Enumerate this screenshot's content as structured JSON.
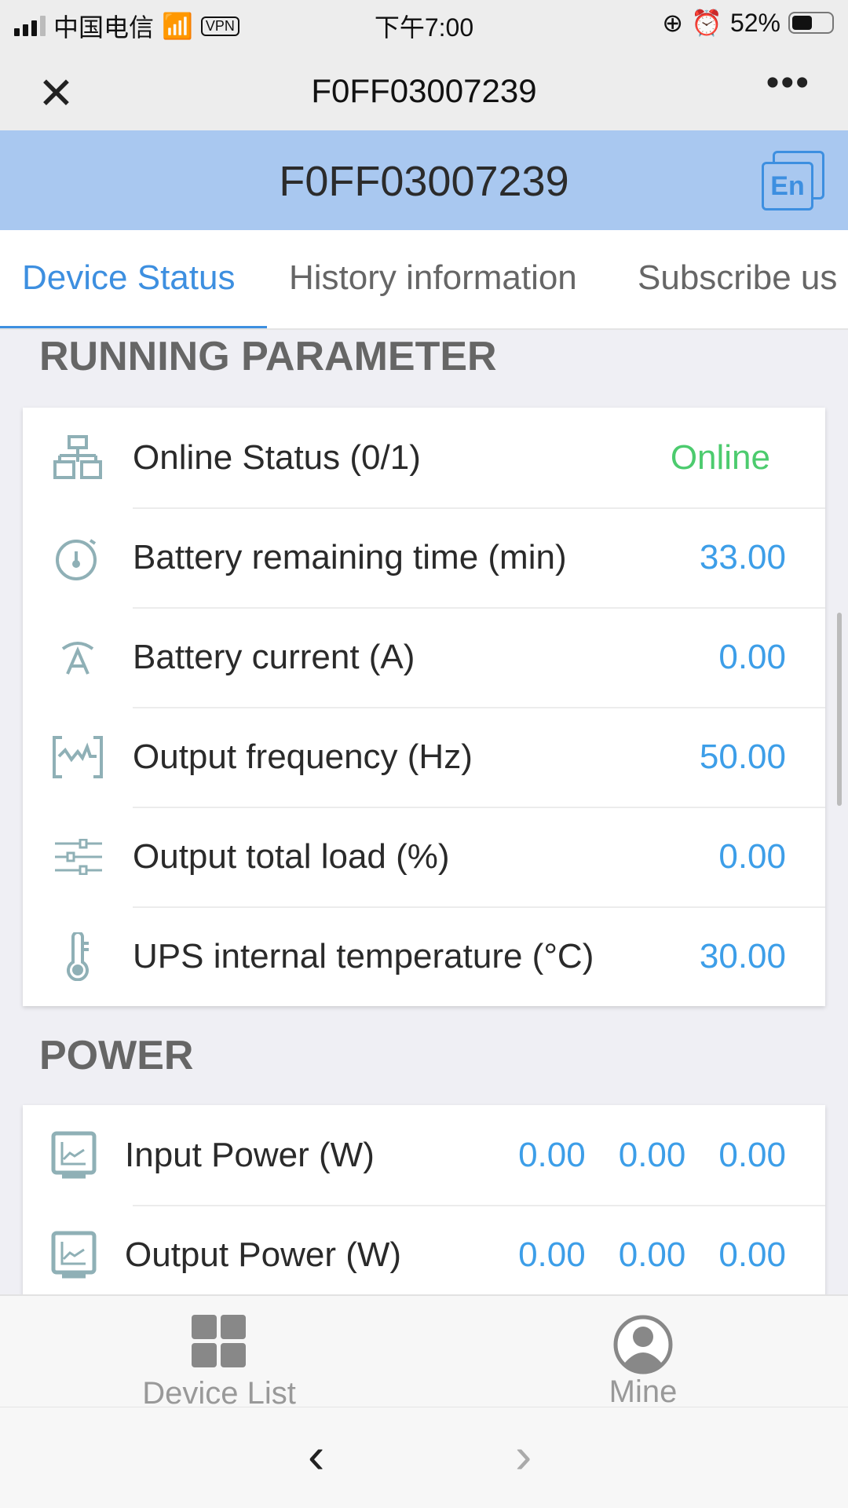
{
  "status_bar": {
    "carrier": "中国电信",
    "vpn": "VPN",
    "time": "下午7:00",
    "battery": "52%",
    "battery_level": 52
  },
  "nav": {
    "title": "F0FF03007239",
    "close_icon": "close-icon",
    "more": "•••"
  },
  "header": {
    "title": "F0FF03007239",
    "lang": "En"
  },
  "tabs": [
    {
      "label": "Device Status",
      "active": true
    },
    {
      "label": "History information"
    },
    {
      "label": "Subscribe us"
    }
  ],
  "running": {
    "title": "RUNNING PARAMETER",
    "rows": [
      {
        "icon": "network-icon",
        "label": "Online Status (0/1)",
        "value": "Online",
        "color": "#4ccb6e"
      },
      {
        "icon": "stopwatch-icon",
        "label": "Battery remaining time (min)",
        "value": "33.00"
      },
      {
        "icon": "current-icon",
        "label": "Battery current (A)",
        "value": "0.00"
      },
      {
        "icon": "waveform-icon",
        "label": "Output frequency (Hz)",
        "value": "50.00"
      },
      {
        "icon": "sliders-icon",
        "label": "Output total load (%)",
        "value": "0.00"
      },
      {
        "icon": "thermometer-icon",
        "label": "UPS internal temperature (°C)",
        "value": "30.00"
      }
    ]
  },
  "power": {
    "title": "POWER",
    "rows": [
      {
        "icon": "chart-monitor-icon",
        "label": "Input Power (W)",
        "values": [
          "0.00",
          "0.00",
          "0.00"
        ]
      },
      {
        "icon": "chart-monitor-icon",
        "label": "Output Power (W)",
        "values": [
          "0.00",
          "0.00",
          "0.00"
        ]
      }
    ]
  },
  "tabbar": {
    "device_list": "Device List",
    "mine": "Mine"
  },
  "colors": {
    "accent": "#3d8fe0",
    "header_bg": "#a9c8f0",
    "value": "#3d9ee8",
    "online": "#4ccb6e",
    "icon": "#8fb0b6"
  }
}
